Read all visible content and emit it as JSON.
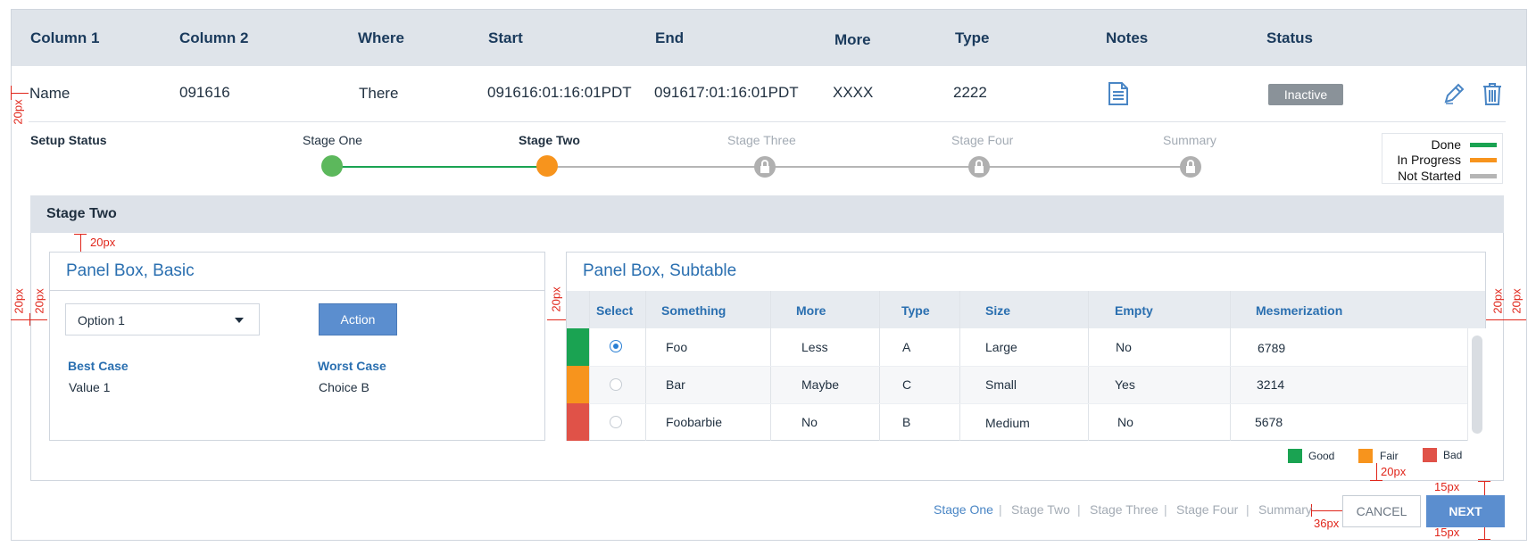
{
  "header": {
    "columns": [
      "Column 1",
      "Column 2",
      "Where",
      "Start",
      "End",
      "More",
      "Type",
      "Notes",
      "Status"
    ]
  },
  "row": {
    "name": "Name",
    "col2": "091616",
    "where": "There",
    "start": "091616:01:16:01PDT",
    "end": "091617:01:16:01PDT",
    "more": "XXXX",
    "type": "2222",
    "status": "Inactive",
    "notes_icon": "document-icon",
    "edit_icon": "pencil-icon",
    "delete_icon": "trash-icon"
  },
  "setup": {
    "label": "Setup Status",
    "stages": [
      {
        "label": "Stage One",
        "state": "done"
      },
      {
        "label": "Stage Two",
        "state": "in_progress"
      },
      {
        "label": "Stage Three",
        "state": "not_started"
      },
      {
        "label": "Stage Four",
        "state": "not_started"
      },
      {
        "label": "Summary",
        "state": "not_started"
      }
    ],
    "legend": [
      {
        "label": "Done",
        "color": "#1aa352"
      },
      {
        "label": "In Progress",
        "color": "#f7941d"
      },
      {
        "label": "Not Started",
        "color": "#b5b5b5"
      }
    ]
  },
  "section": {
    "title": "Stage Two",
    "basic": {
      "title": "Panel Box, Basic",
      "select_value": "Option 1",
      "action_label": "Action",
      "best_label": "Best Case",
      "best_value": "Value 1",
      "worst_label": "Worst Case",
      "worst_value": "Choice B"
    },
    "subtable": {
      "title": "Panel Box, Subtable",
      "columns": [
        "Select",
        "Something",
        "More",
        "Type",
        "Size",
        "Empty",
        "Mesmerization"
      ],
      "rows": [
        {
          "something": "Foo",
          "more": "Less",
          "type": "A",
          "size": "Large",
          "empty": "No",
          "mes": "6789",
          "selected": true,
          "status": "good"
        },
        {
          "something": "Bar",
          "more": "Maybe",
          "type": "C",
          "size": "Small",
          "empty": "Yes",
          "mes": "3214",
          "selected": false,
          "status": "fair"
        },
        {
          "something": "Foobarbie",
          "more": "No",
          "type": "B",
          "size": "Medium",
          "empty": "No",
          "mes": "5678",
          "selected": false,
          "status": "bad"
        }
      ],
      "legend": [
        {
          "label": "Good",
          "color": "#1aa352"
        },
        {
          "label": "Fair",
          "color": "#f7941d"
        },
        {
          "label": "Bad",
          "color": "#e05248"
        }
      ]
    }
  },
  "footer": {
    "crumbs": [
      "Stage One",
      "Stage Two",
      "Stage Three",
      "Stage Four",
      "Summary"
    ],
    "separator": "|",
    "cancel_label": "CANCEL",
    "next_label": "NEXT"
  },
  "annotations": {
    "a20": "20px",
    "a15": "15px",
    "a36": "36px"
  },
  "colors": {
    "accent": "#4a86c5",
    "link": "#2a6fb0",
    "header_bg": "#dfe4ea",
    "spec_red": "#e0261b"
  }
}
